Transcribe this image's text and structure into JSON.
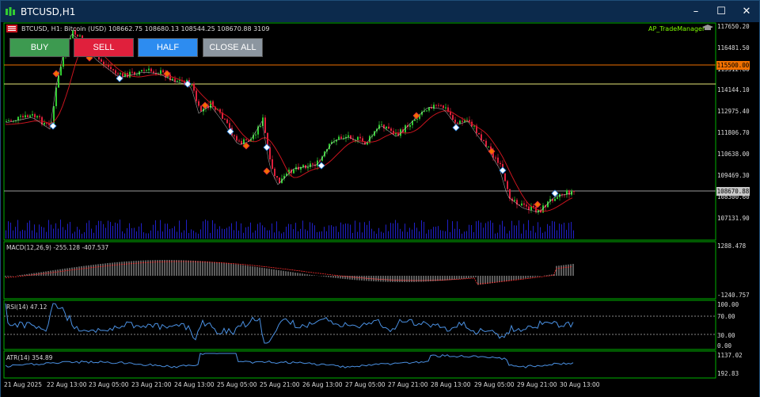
{
  "window": {
    "title": "BTCUSD,H1",
    "minimize": "–",
    "maximize": "☐",
    "close": "✕"
  },
  "chart": {
    "symbol_line": "BTCUSD, H1:  Bitcoin (USD)  108662.75  108680.13  108544.25  108670.88  3109",
    "trade_manager": "AP_TradeManager"
  },
  "buttons": {
    "buy": "BUY",
    "sell": "SELL",
    "half": "HALF",
    "close_all": "CLOSE ALL"
  },
  "price_axis": {
    "labels": [
      "117650.20",
      "116481.50",
      "115312.80",
      "114144.10",
      "112975.40",
      "111806.70",
      "110638.00",
      "109469.30",
      "108300.60",
      "107131.90"
    ],
    "tag_sell": "115500.00",
    "tag_current": "108670.88"
  },
  "macd": {
    "label": "MACD(12,26,9) -255.128 -407.537",
    "max": "1288.478",
    "min": "-1240.757"
  },
  "rsi": {
    "label": "RSI(14) 47.12",
    "levels": [
      "100.00",
      "70.00",
      "30.00",
      "0.00"
    ]
  },
  "atr": {
    "label": "ATR(14) 354.89",
    "max": "1137.02",
    "min": "192.83"
  },
  "time_axis": [
    "21 Aug 2025",
    "22 Aug 13:00",
    "23 Aug 05:00",
    "23 Aug 21:00",
    "24 Aug 13:00",
    "25 Aug 05:00",
    "25 Aug 21:00",
    "26 Aug 13:00",
    "27 Aug 05:00",
    "27 Aug 21:00",
    "28 Aug 13:00",
    "29 Aug 05:00",
    "29 Aug 21:00",
    "30 Aug 13:00"
  ],
  "colors": {
    "up_candle": "#32cd32",
    "down_candle": "#e0203c",
    "border": "#00b000",
    "ma": "#c8141e",
    "volume": "#2020c8",
    "level_orange": "#f07000",
    "level_yellow": "#e6e678",
    "rsi_line": "#4a90e2",
    "macd_signal": "#ff3030"
  }
}
